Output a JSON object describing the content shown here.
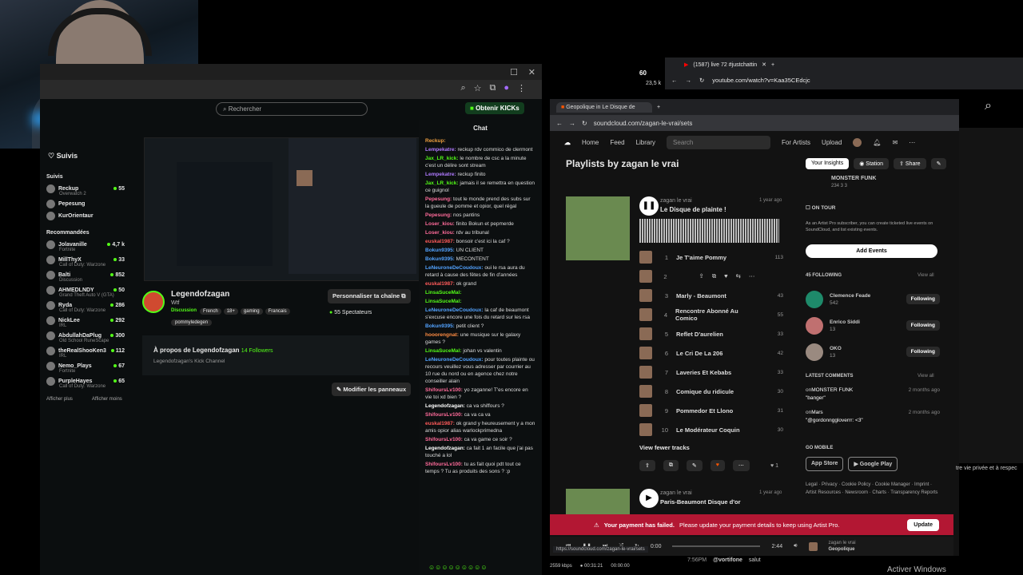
{
  "taskbar": {
    "icons": [
      "kick-icon",
      "obs-icon",
      "discord-icon"
    ],
    "coins": "60",
    "viewers": "23,5 k"
  },
  "kick": {
    "search_placeholder": "Rechercher",
    "obtain_kicks": "Obtenir KICKs",
    "suivis_title": "Suivis",
    "suivis_section": "Suivis",
    "following": [
      {
        "name": "Reckup",
        "sub": "Overwatch 2",
        "count": "55"
      },
      {
        "name": "Pepesung",
        "sub": "",
        "count": ""
      },
      {
        "name": "KurOrientaur",
        "sub": "",
        "count": ""
      }
    ],
    "recommended_title": "Recommandées",
    "recommended": [
      {
        "name": "Jolavanille",
        "sub": "Fortnite",
        "count": "4,7 k"
      },
      {
        "name": "MillThyX",
        "sub": "Call of Duty: Warzone",
        "count": "33"
      },
      {
        "name": "Balti",
        "sub": "Discussion",
        "count": "852"
      },
      {
        "name": "AHMEDLNDY",
        "sub": "Grand Theft Auto V (GTA)",
        "count": "50"
      },
      {
        "name": "Ryda",
        "sub": "Call of Duty: Warzone",
        "count": "286"
      },
      {
        "name": "NickLee",
        "sub": "IRL",
        "count": "292"
      },
      {
        "name": "AbdullahDaPlug",
        "sub": "Old School RuneScape",
        "count": "300"
      },
      {
        "name": "theRealShooKen3",
        "sub": "IRL",
        "count": "112"
      },
      {
        "name": "Nemo_Plays",
        "sub": "Fortnite",
        "count": "67"
      },
      {
        "name": "PurpleHayes",
        "sub": "Call of Duty: Warzone",
        "count": "65"
      }
    ],
    "show_more": "Afficher plus",
    "show_less": "Afficher moins",
    "channel_name": "Legendofzagan",
    "channel_sub": "Wtf",
    "category": "Discussion",
    "tags": [
      "French",
      "18+",
      "gaming",
      "Francais"
    ],
    "extra_tag": "pommyledegen",
    "customize": "Personnaliser ta chaîne",
    "viewers": "55 Spectateurs",
    "about_title": "À propos de Legendofzagan",
    "followers": "14 Followers",
    "about_text": "Legendofzagan's Kick Channel",
    "edit_panels": "Modifier les panneaux",
    "chat_title": "Chat",
    "chat": [
      {
        "u": "Reckup:",
        "t": "",
        "c": "#f0a040"
      },
      {
        "u": "Lempekatre:",
        "t": "reckup rdv commico de clermont",
        "c": "#b07aff"
      },
      {
        "u": "Jax_LR_kick:",
        "t": "le nombre de csc a la minute c'est un délire sont stream",
        "c": "#53fc18"
      },
      {
        "u": "Lempekatre:",
        "t": "reckup finito",
        "c": "#b07aff"
      },
      {
        "u": "Jax_LR_kick:",
        "t": "jamais il se remettra en question ce guignol",
        "c": "#53fc18"
      },
      {
        "u": "Pepesung:",
        "t": "tout le monde prend des subs sur la gueule de pomme et opior, quel régal",
        "c": "#ff6b9a"
      },
      {
        "u": "Pepesung:",
        "t": "nos pantins",
        "c": "#ff6b9a"
      },
      {
        "u": "Loser_kiou:",
        "t": "finito Bokun et pepmerde",
        "c": "#ff6b9a"
      },
      {
        "u": "Loser_kiou:",
        "t": "rdv au tribunal",
        "c": "#ff6b9a"
      },
      {
        "u": "euskal1987:",
        "t": "bonsoir c'est ici la caf ?",
        "c": "#ff5a5a"
      },
      {
        "u": "Bokun9395:",
        "t": "UN CLIENT",
        "c": "#53a3ff"
      },
      {
        "u": "Bokun9395:",
        "t": "MECONTENT",
        "c": "#53a3ff"
      },
      {
        "u": "LeNeuroneDeCoudoux:",
        "t": "oui le rsa aura du retard à cause des fêtes de fin d'années",
        "c": "#53a3ff"
      },
      {
        "u": "euskal1987:",
        "t": "ok grand",
        "c": "#ff5a5a"
      },
      {
        "u": "LinsaSuceMal:",
        "t": "",
        "c": "#53fc18"
      },
      {
        "u": "LinsaSuceMal:",
        "t": "",
        "c": "#53fc18"
      },
      {
        "u": "LeNeuroneDeCoudoux:",
        "t": "la caf de beaumont s'excuse encore une fois du retard sur les rsa",
        "c": "#53a3ff"
      },
      {
        "u": "Bokun9395:",
        "t": "petit client ?",
        "c": "#53a3ff"
      },
      {
        "u": "hooorengnat:",
        "t": "une musique sur le galaxy games ?",
        "c": "#ff8c42"
      },
      {
        "u": "LinsaSuceMal:",
        "t": "johan vs valentin",
        "c": "#53fc18"
      },
      {
        "u": "LeNeuroneDeCoudoux:",
        "t": "pour toutes plainte ou recours veuillez vous adresser par courrier au 10 rue du nord ou en agence chez notre conseiller alain",
        "c": "#53a3ff"
      },
      {
        "u": "ShifoursLv100:",
        "t": "yo zaganne! T'es encore en vie toi xd bien ?",
        "c": "#ff6b9a"
      },
      {
        "u": "Legendofzagan:",
        "t": "ca va shiffours ?",
        "c": "#fff"
      },
      {
        "u": "ShifoursLv100:",
        "t": "ca va ca va",
        "c": "#ff6b9a"
      },
      {
        "u": "euskal1987:",
        "t": "ok grand y heureusement y a mon amis opior alias warlockprimedna",
        "c": "#ff5a5a"
      },
      {
        "u": "ShifoursLv100:",
        "t": "ca va game ce soir ?",
        "c": "#ff6b9a"
      },
      {
        "u": "Legendofzagan:",
        "t": "ca fait 1 an facile que j'ai pas touché a lol",
        "c": "#fff"
      },
      {
        "u": "ShifoursLv100:",
        "t": "tu as fait quoi pdt tout ce temps ? Tu as produits des sons ? :p",
        "c": "#ff6b9a"
      }
    ]
  },
  "soundcloud": {
    "tab_title": "Geopolique in Le Disque de",
    "url": "soundcloud.com/zagan-le-vrai/sets",
    "nav": [
      "Home",
      "Feed",
      "Library"
    ],
    "search_placeholder": "Search",
    "for_artists": "For Artists",
    "upload": "Upload",
    "page_title": "Playlists by zagan le vrai",
    "insights": "Your Insights",
    "station": "Station",
    "share": "Share",
    "artist": "zagan le vrai",
    "playlist_title": "Le Disque de plainte !",
    "age": "1 year ago",
    "tracks": [
      {
        "n": "1",
        "t": "Je T'aime Pommy",
        "p": "113"
      },
      {
        "n": "2",
        "t": "",
        "p": ""
      },
      {
        "n": "3",
        "t": "Marly - Beaumont",
        "p": "43"
      },
      {
        "n": "4",
        "t": "Rencontre Abonné Au Comico",
        "p": "55"
      },
      {
        "n": "5",
        "t": "Reflet D'aurelien",
        "p": "33"
      },
      {
        "n": "6",
        "t": "Le Cri De La 206",
        "p": "42"
      },
      {
        "n": "7",
        "t": "Laveries Et Kebabs",
        "p": "33"
      },
      {
        "n": "8",
        "t": "Comique du ridicule",
        "p": "30"
      },
      {
        "n": "9",
        "t": "Pommedor Et Llono",
        "p": "31"
      },
      {
        "n": "10",
        "t": "Le Modérateur Coquin",
        "p": "30"
      }
    ],
    "view_fewer": "View fewer tracks",
    "likes": "1",
    "second_artist": "zagan le vrai",
    "second_title": "Paris-Beaumont Disque d'or",
    "second_age": "1 year ago",
    "monster_funk": "MONSTER FUNK",
    "monster_stats": "234   3   3",
    "on_tour": "ON TOUR",
    "tour_text": "As an Artist Pro subscriber, you can create ticketed live events on SoundCloud, and list existing events.",
    "add_events": "Add Events",
    "following_title": "45 FOLLOWING",
    "view_all": "View all",
    "following": [
      {
        "name": "Clemence Feade",
        "stats": "542"
      },
      {
        "name": "Enrico Siddi",
        "stats": "13"
      },
      {
        "name": "OKO",
        "stats": "13"
      }
    ],
    "following_btn": "Following",
    "latest_comments": "LATEST COMMENTS",
    "comments": [
      {
        "on": "MONSTER FUNK",
        "when": "2 months ago",
        "text": "\"banger\""
      },
      {
        "on": "Mars",
        "when": "2 months ago",
        "text": "\"@gordonnggloverrr: <3\""
      }
    ],
    "go_mobile": "GO MOBILE",
    "app_store": "App Store",
    "google_play": "Google Play",
    "footer": "Legal · Privacy · Cookie Policy · Cookie Manager · Imprint · Artist Resources · Newsroom · Charts · Transparency Reports",
    "banner_bold": "Your payment has failed.",
    "banner_text": "Please update your payment details to keep using Artist Pro.",
    "update": "Update",
    "time_cur": "0:00",
    "time_total": "2:44",
    "now_artist": "zagan le vrai",
    "now_title": "Geopolique",
    "status_url": "https://soundcloud.com/zagan-le-vrai/sets"
  },
  "youtube": {
    "tab": "(1587) live 72 #justchattin",
    "url": "youtube.com/watch?v=Kaa35CEdcjc"
  },
  "bottom": {
    "kbps": "2559 kbps",
    "time": "00:31:21",
    "time2": "00:00:00",
    "chat_time": "7:56PM",
    "chat_user": "@vortifone",
    "chat_msg": "salut",
    "activate": "Activer Windows",
    "side_text": "tre vie privée et à respec"
  }
}
